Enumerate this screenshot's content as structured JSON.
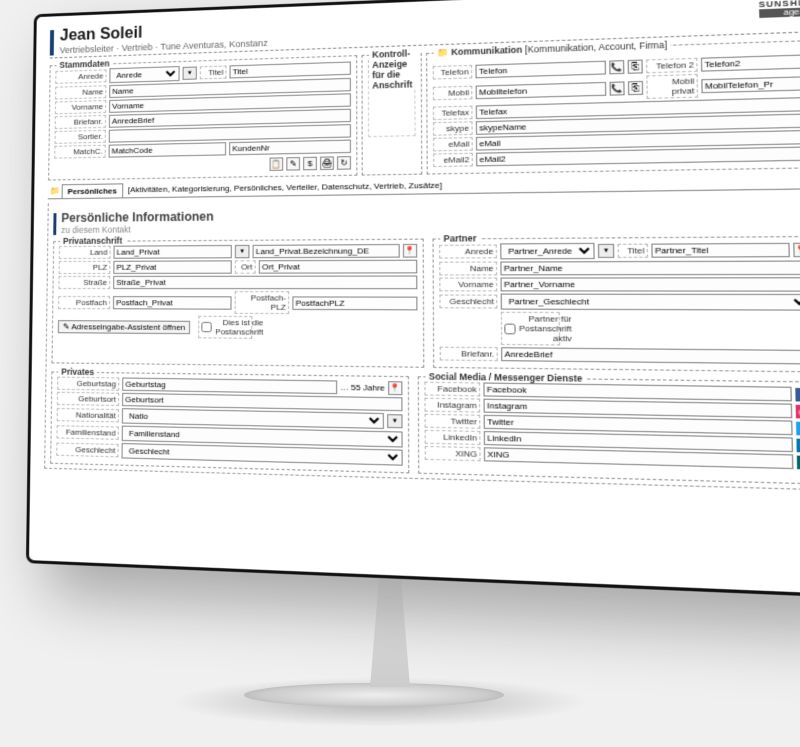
{
  "header": {
    "name": "Jean Soleil",
    "subtitle": "Vertriebsleiter · Vertrieb · Tune Aventuras, Konstanz"
  },
  "brand": {
    "line1": "SUNSHINE",
    "line2": "agency"
  },
  "stammdaten": {
    "legend": "Stammdaten",
    "anrede_lbl": "Anrede",
    "anrede_val": "Anrede",
    "titel_lbl": "Titel",
    "titel_val": "Titel",
    "name_lbl": "Name",
    "name_val": "Name",
    "vorname_lbl": "Vorname",
    "vorname_val": "Vorname",
    "briefan_lbl": "Briefanr.",
    "briefan_val": "AnredeBrief",
    "sortier_lbl": "Sortier.",
    "sortier_val": "",
    "match_lbl": "MatchC.",
    "match_val": "MatchCode",
    "kunden_val": "KundenNr"
  },
  "kontroll": {
    "legend": "Kontroll-Anzeige für die Anschrift",
    "anschrift_lbl": "Anschrift"
  },
  "komm": {
    "legend": "Kommunikation",
    "tabs_rest": "[Kommunikation, Account, Firma]",
    "tel_lbl": "Telefon",
    "tel_val": "Telefon",
    "tel2_lbl": "Telefon 2",
    "tel2_val": "Telefon2",
    "mobil_lbl": "Mobil",
    "mobil_val": "Mobiltelefon",
    "mobilp_lbl": "Mobil privat",
    "mobilp_val": "MobilTelefon_Pr",
    "fax_lbl": "Telefax",
    "fax_val": "Telefax",
    "skype_lbl": "skype",
    "skype_val": "skypeName",
    "email_lbl": "eMail",
    "email_val": "eMail",
    "email2_lbl": "eMail2",
    "email2_val": "eMail2"
  },
  "tabs": {
    "active": "Persönliches",
    "rest": "[Aktivitäten, Kategorisierung, Persönliches, Verteiler, Datenschutz, Vertrieb, Zusätze]"
  },
  "panel": {
    "title": "Persönliche Informationen",
    "subtitle": "zu diesem Kontakt"
  },
  "privadr": {
    "legend": "Privatanschrift",
    "land_lbl": "Land",
    "land_val": "Land_Privat",
    "landbez_val": "Land_Privat.Bezeichnung_DE",
    "plz_lbl": "PLZ",
    "plz_val": "PLZ_Privat",
    "ort_lbl": "Ort",
    "ort_val": "Ort_Privat",
    "str_lbl": "Straße",
    "str_val": "Straße_Privat",
    "pf_lbl": "Postfach",
    "pf_val": "Postfach_Privat",
    "pfplz_lbl": "Postfach-PLZ",
    "pfplz_val": "PostfachPLZ",
    "assist_btn": "Adresseingabe-Assistent öffnen",
    "postchk": "Dies ist die Postanschrift"
  },
  "partner": {
    "legend": "Partner",
    "anrede_lbl": "Anrede",
    "anrede_val": "Partner_Anrede",
    "titel_lbl": "Titel",
    "titel_val": "Partner_Titel",
    "name_lbl": "Name",
    "name_val": "Partner_Name",
    "vorname_lbl": "Vorname",
    "vorname_val": "Partner_Vorname",
    "gesch_lbl": "Geschlecht",
    "gesch_val": "Partner_Geschlecht",
    "postchk": "Partner für Postanschrift aktiv",
    "brief_lbl": "Briefanr.",
    "brief_val": "AnredeBrief"
  },
  "privates": {
    "legend": "Privates",
    "geb_lbl": "Geburtstag",
    "geb_val": "Geburtstag",
    "age": "… 55 Jahre",
    "gebort_lbl": "Geburtsort",
    "gebort_val": "Geburtsort",
    "nat_lbl": "Nationalität",
    "nat_val": "Natio",
    "fam_lbl": "Familienstand",
    "fam_val": "Familienstand",
    "gesch_lbl": "Geschlecht",
    "gesch_val": "Geschlecht"
  },
  "social": {
    "legend": "Social Media / Messenger Dienste",
    "fb_lbl": "Facebook",
    "fb_val": "Facebook",
    "ig_lbl": "Instagram",
    "ig_val": "Instagram",
    "tw_lbl": "Twitter",
    "tw_val": "Twitter",
    "li_lbl": "LinkedIn",
    "li_val": "LinkedIn",
    "xi_lbl": "XING",
    "xi_val": "XING"
  }
}
